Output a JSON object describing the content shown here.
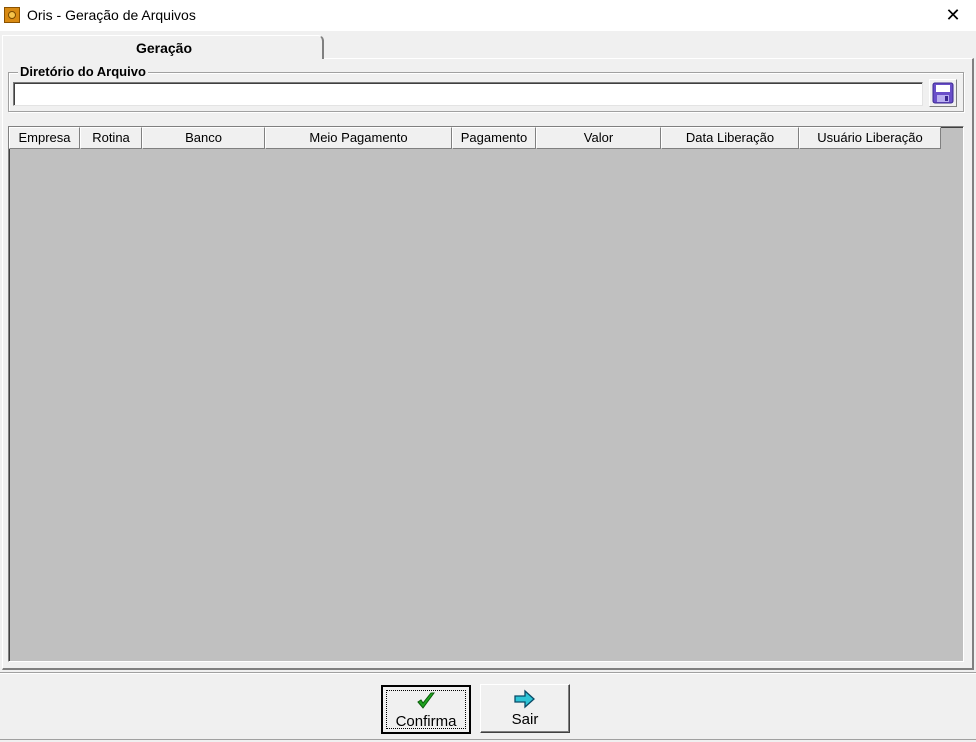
{
  "window": {
    "title": "Oris - Geração de Arquivos",
    "icons": {
      "app": "oris-app-icon",
      "close": "close-icon"
    },
    "close_glyph": "✕"
  },
  "tabs": [
    {
      "label": "Geração",
      "selected": true
    }
  ],
  "directory": {
    "group_label": "Diretório do Arquivo",
    "value": "",
    "placeholder": "",
    "save_icon": "floppy-disk-icon"
  },
  "grid": {
    "columns": [
      "Empresa",
      "Rotina",
      "Banco",
      "Meio Pagamento",
      "Pagamento",
      "Valor",
      "Data Liberação",
      "Usuário Liberação"
    ],
    "rows": []
  },
  "buttons": {
    "confirm": {
      "label": "Confirma",
      "icon": "checkmark-icon"
    },
    "exit": {
      "label": "Sair",
      "icon": "arrow-right-icon"
    }
  },
  "colors": {
    "grid_background": "#c0c0c0",
    "face": "#f0f0f0",
    "checkmark": "#1fa31f",
    "arrow": "#2ec4d6"
  }
}
